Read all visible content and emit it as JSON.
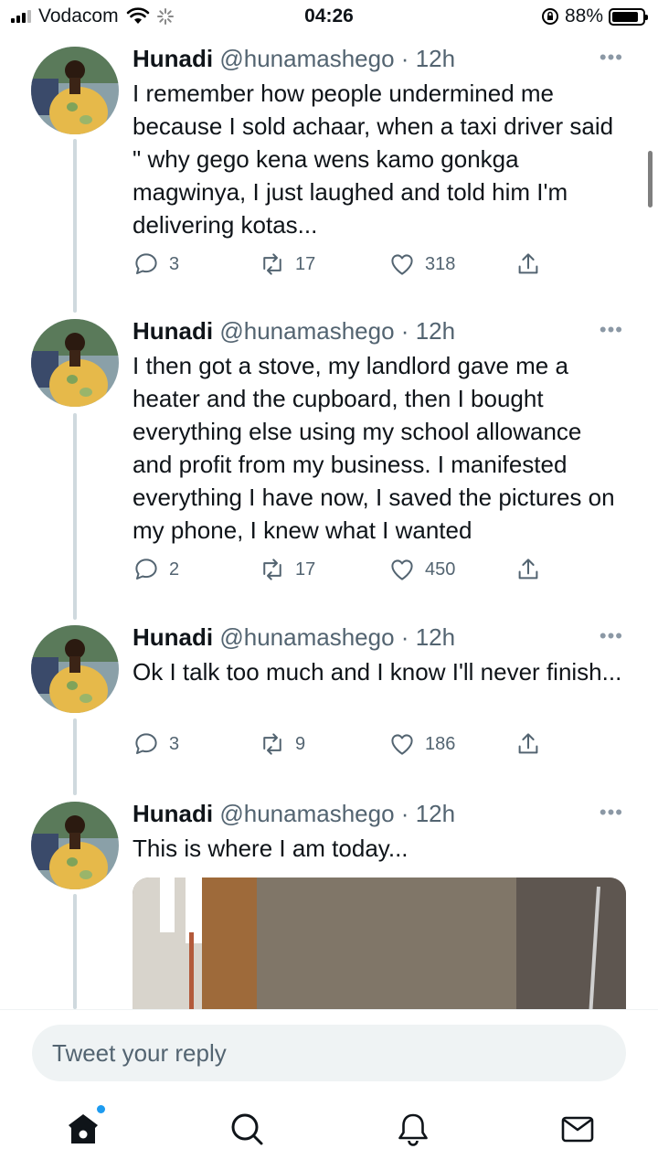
{
  "status_bar": {
    "carrier": "Vodacom",
    "time": "04:26",
    "battery_percent": "88%",
    "battery_level": 0.88
  },
  "tweets": [
    {
      "name": "Hunadi",
      "handle": "@hunamashego",
      "dot": "·",
      "time": "12h",
      "text": "I remember how people undermined me because I sold achaar, when a taxi driver said \" why gego kena wens kamo gonkga magwinya, I just laughed and told him I'm delivering kotas...",
      "replies": "3",
      "retweets": "17",
      "likes": "318"
    },
    {
      "name": "Hunadi",
      "handle": "@hunamashego",
      "dot": "·",
      "time": "12h",
      "text": "I then got a stove, my landlord gave me a heater and the cupboard, then I bought everything else using my school allowance and profit from my business. I manifested everything I have now, I saved the pictures on my phone, I knew what I wanted",
      "replies": "2",
      "retweets": "17",
      "likes": "450"
    },
    {
      "name": "Hunadi",
      "handle": "@hunamashego",
      "dot": "·",
      "time": "12h",
      "text": "Ok I talk too much and I know I'll never finish...",
      "replies": "3",
      "retweets": "9",
      "likes": "186"
    },
    {
      "name": "Hunadi",
      "handle": "@hunamashego",
      "dot": "·",
      "time": "12h",
      "text": "This is where I am today..."
    }
  ],
  "more_glyph": "•••",
  "reply": {
    "placeholder": "Tweet your reply"
  },
  "icons": {
    "reply": "reply-icon",
    "retweet": "retweet-icon",
    "like": "heart-icon",
    "share": "share-icon",
    "home": "home-icon",
    "search": "search-icon",
    "notifications": "bell-icon",
    "messages": "mail-icon"
  },
  "colors": {
    "accent": "#1d9bf0",
    "text": "#0f1419",
    "secondary": "#536471",
    "thread_line": "#cfd9de"
  }
}
